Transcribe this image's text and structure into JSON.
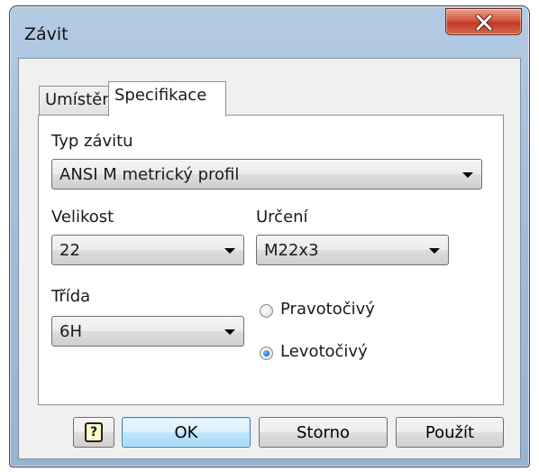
{
  "window": {
    "title": "Závit"
  },
  "tabs": [
    {
      "label": "Umístění",
      "active": false
    },
    {
      "label": "Specifikace",
      "active": true
    }
  ],
  "thread_type": {
    "label": "Typ závitu",
    "value": "ANSI M metrický profil"
  },
  "size": {
    "label": "Velikost",
    "value": "22"
  },
  "designation": {
    "label": "Určení",
    "value": "M22x3"
  },
  "class": {
    "label": "Třída",
    "value": "6H"
  },
  "direction": {
    "options": [
      {
        "label": "Pravotočivý",
        "checked": false
      },
      {
        "label": "Levotočivý",
        "checked": true
      }
    ]
  },
  "buttons": {
    "help_icon": "help-question-icon",
    "ok": "OK",
    "cancel": "Storno",
    "apply": "Použít"
  },
  "colors": {
    "ok_accent": "#a7d9f5",
    "close_button": "#c23a20",
    "radio_checked": "#1a6fd1"
  }
}
